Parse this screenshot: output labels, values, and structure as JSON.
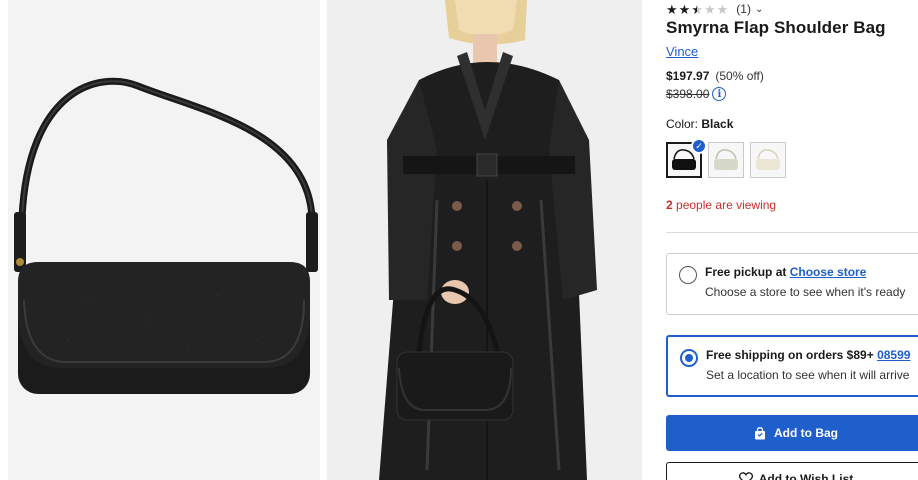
{
  "product": {
    "rating": {
      "value": 2.5,
      "max": 5,
      "count_label": "(1)"
    },
    "title": "Smyrna Flap Shoulder Bag",
    "brand": "Vince",
    "price_now": "$197.97",
    "discount": "(50% off)",
    "price_original": "$398.00",
    "color_label": "Color:",
    "color_value": "Black",
    "swatches": [
      "Black",
      "Sage",
      "Cream"
    ],
    "viewing_count": "2",
    "viewing_text": "people are viewing"
  },
  "fulfillment": {
    "pickup": {
      "label": "Free pickup at",
      "link": "Choose store",
      "sub": "Choose a store to see when it's ready",
      "selected": false
    },
    "shipping": {
      "label": "Free shipping on orders $89+",
      "link": "08599",
      "sub": "Set a location to see when it will arrive",
      "selected": true
    }
  },
  "actions": {
    "add_to_bag": "Add to Bag",
    "add_to_wishlist": "Add to Wish List"
  },
  "icons": {
    "info": "info-icon",
    "bag": "shopping-bag-icon",
    "heart": "heart-icon",
    "check": "check-icon",
    "chevron": "chevron-down-icon"
  },
  "colors": {
    "accent": "#1f5fcc",
    "alert": "#c8312a"
  }
}
